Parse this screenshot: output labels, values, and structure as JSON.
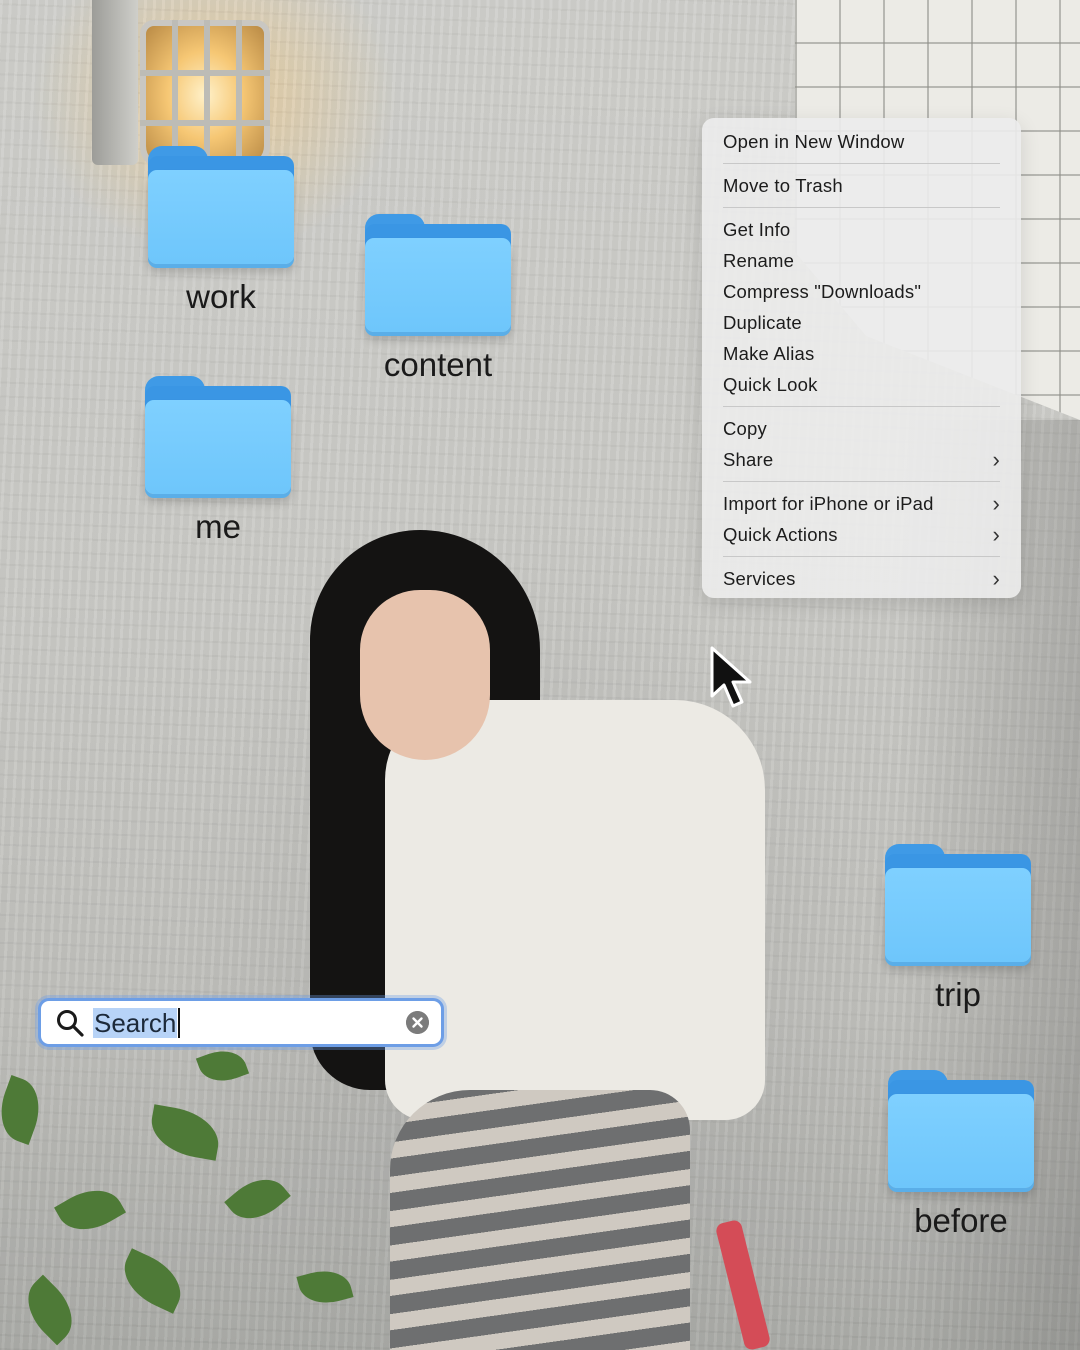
{
  "desktop": {
    "folders": [
      {
        "label": "work"
      },
      {
        "label": "content"
      },
      {
        "label": "me"
      },
      {
        "label": "trip"
      },
      {
        "label": "before"
      }
    ]
  },
  "context_menu": {
    "items": [
      {
        "label": "Open in New Window"
      },
      {
        "label": "Move to Trash"
      },
      {
        "label": "Get Info"
      },
      {
        "label": "Rename"
      },
      {
        "label": "Compress \"Downloads\""
      },
      {
        "label": "Duplicate"
      },
      {
        "label": "Make Alias"
      },
      {
        "label": "Quick Look"
      },
      {
        "label": "Copy"
      },
      {
        "label": "Share",
        "submenu": true
      },
      {
        "label": "Import for iPhone or iPad",
        "submenu": true
      },
      {
        "label": "Quick Actions",
        "submenu": true
      },
      {
        "label": "Services",
        "submenu": true
      }
    ],
    "chevron": "›"
  },
  "search": {
    "value": "Search",
    "icon": "search-icon",
    "clear_icon": "clear-icon"
  },
  "colors": {
    "folder_front": "#7fd0ff",
    "folder_back": "#3a96e4",
    "search_focus_ring": "#6d9ee6",
    "selection": "#b7d3f7"
  }
}
